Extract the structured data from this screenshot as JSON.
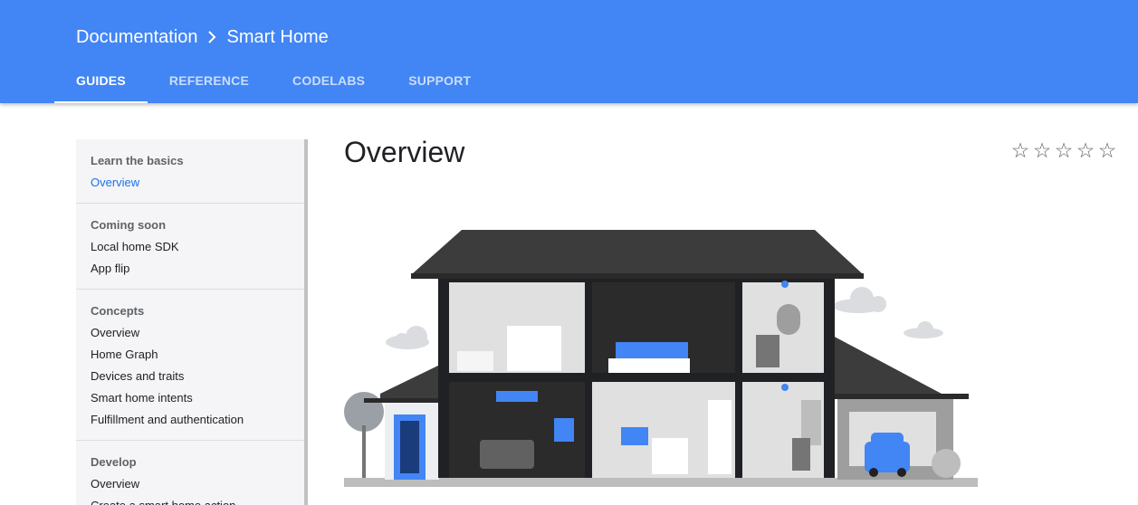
{
  "header": {
    "breadcrumb": [
      "Documentation",
      "Smart Home"
    ],
    "tabs": [
      {
        "label": "GUIDES",
        "active": true
      },
      {
        "label": "REFERENCE"
      },
      {
        "label": "CODELABS"
      },
      {
        "label": "SUPPORT"
      }
    ],
    "color": "#4285f4"
  },
  "sidebar": {
    "sections": [
      {
        "heading": "Learn the basics",
        "items": [
          "Overview"
        ],
        "active": "Overview"
      },
      {
        "heading": "Coming soon",
        "items": [
          "Local home SDK",
          "App flip"
        ]
      },
      {
        "heading": "Concepts",
        "items": [
          "Overview",
          "Home Graph",
          "Devices and traits",
          "Smart home intents",
          "Fulfillment and authentication"
        ]
      },
      {
        "heading": "Develop",
        "items": [
          "Overview",
          "Create a smart home action"
        ]
      }
    ]
  },
  "main": {
    "title": "Overview",
    "rating": {
      "stars": 5,
      "value": 0
    },
    "illustration": {
      "icon": "smart-home-house-illustration"
    }
  }
}
